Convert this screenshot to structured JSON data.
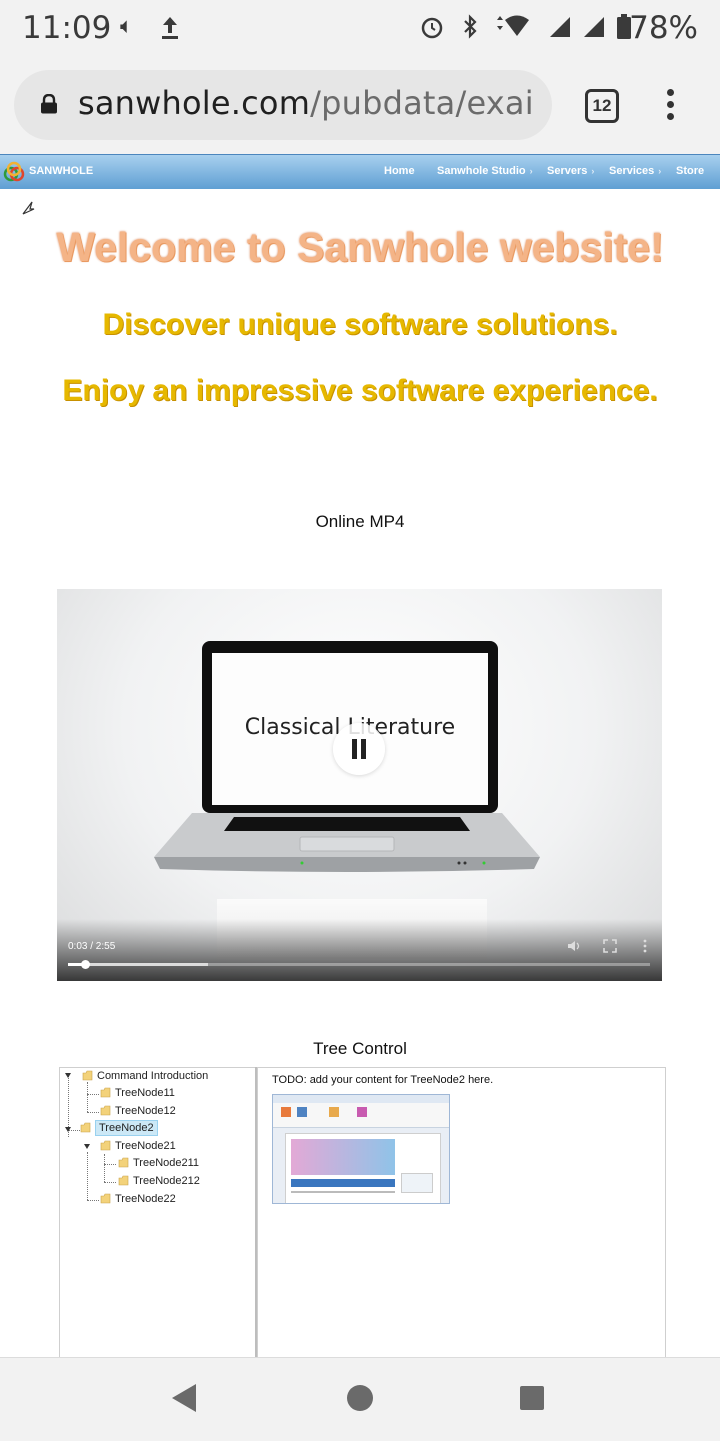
{
  "status_bar": {
    "time": "11:09",
    "icons": [
      "volume-icon",
      "upload-icon",
      "alarm-icon",
      "bluetooth-icon",
      "data-arrows-icon",
      "wifi-icon",
      "signal-icon",
      "signal-icon",
      "battery-icon"
    ],
    "battery": "78%"
  },
  "browser": {
    "url_domain": "sanwhole.com",
    "url_path": "/pubdata/exai",
    "tab_count": "12"
  },
  "site_nav": {
    "brand": "SANWHOLE",
    "items": [
      {
        "label": "Home",
        "has_chevron": false
      },
      {
        "label": "Sanwhole Studio",
        "has_chevron": true
      },
      {
        "label": "Servers",
        "has_chevron": true
      },
      {
        "label": "Services",
        "has_chevron": true
      },
      {
        "label": "Store",
        "has_chevron": false
      }
    ],
    "chevron": "›"
  },
  "hero": {
    "title": "Welcome to Sanwhole website!",
    "tagline_1": "Discover unique software solutions.",
    "tagline_2": "Enjoy an impressive software experience."
  },
  "video_section": {
    "label": "Online MP4",
    "display_text": "Classical Literature",
    "time": "0:03 / 2:55",
    "progress_fraction": 0.03,
    "buffered_fraction": 0.24
  },
  "tree_section": {
    "label": "Tree Control",
    "nodes": [
      {
        "label": "Command Introduction"
      },
      {
        "label": "TreeNode11"
      },
      {
        "label": "TreeNode12"
      },
      {
        "label": "TreeNode2",
        "selected": true
      },
      {
        "label": "TreeNode21"
      },
      {
        "label": "TreeNode211"
      },
      {
        "label": "TreeNode212"
      },
      {
        "label": "TreeNode22"
      }
    ],
    "content_text": "TODO: add your content for TreeNode2 here."
  },
  "colors": {
    "nav_gradient_top": "#a8d0ee",
    "nav_gradient_bottom": "#5f9fd3",
    "welcome": "#f4b487",
    "tagline": "#e6b800",
    "tree_selected": "#cce8f6"
  }
}
